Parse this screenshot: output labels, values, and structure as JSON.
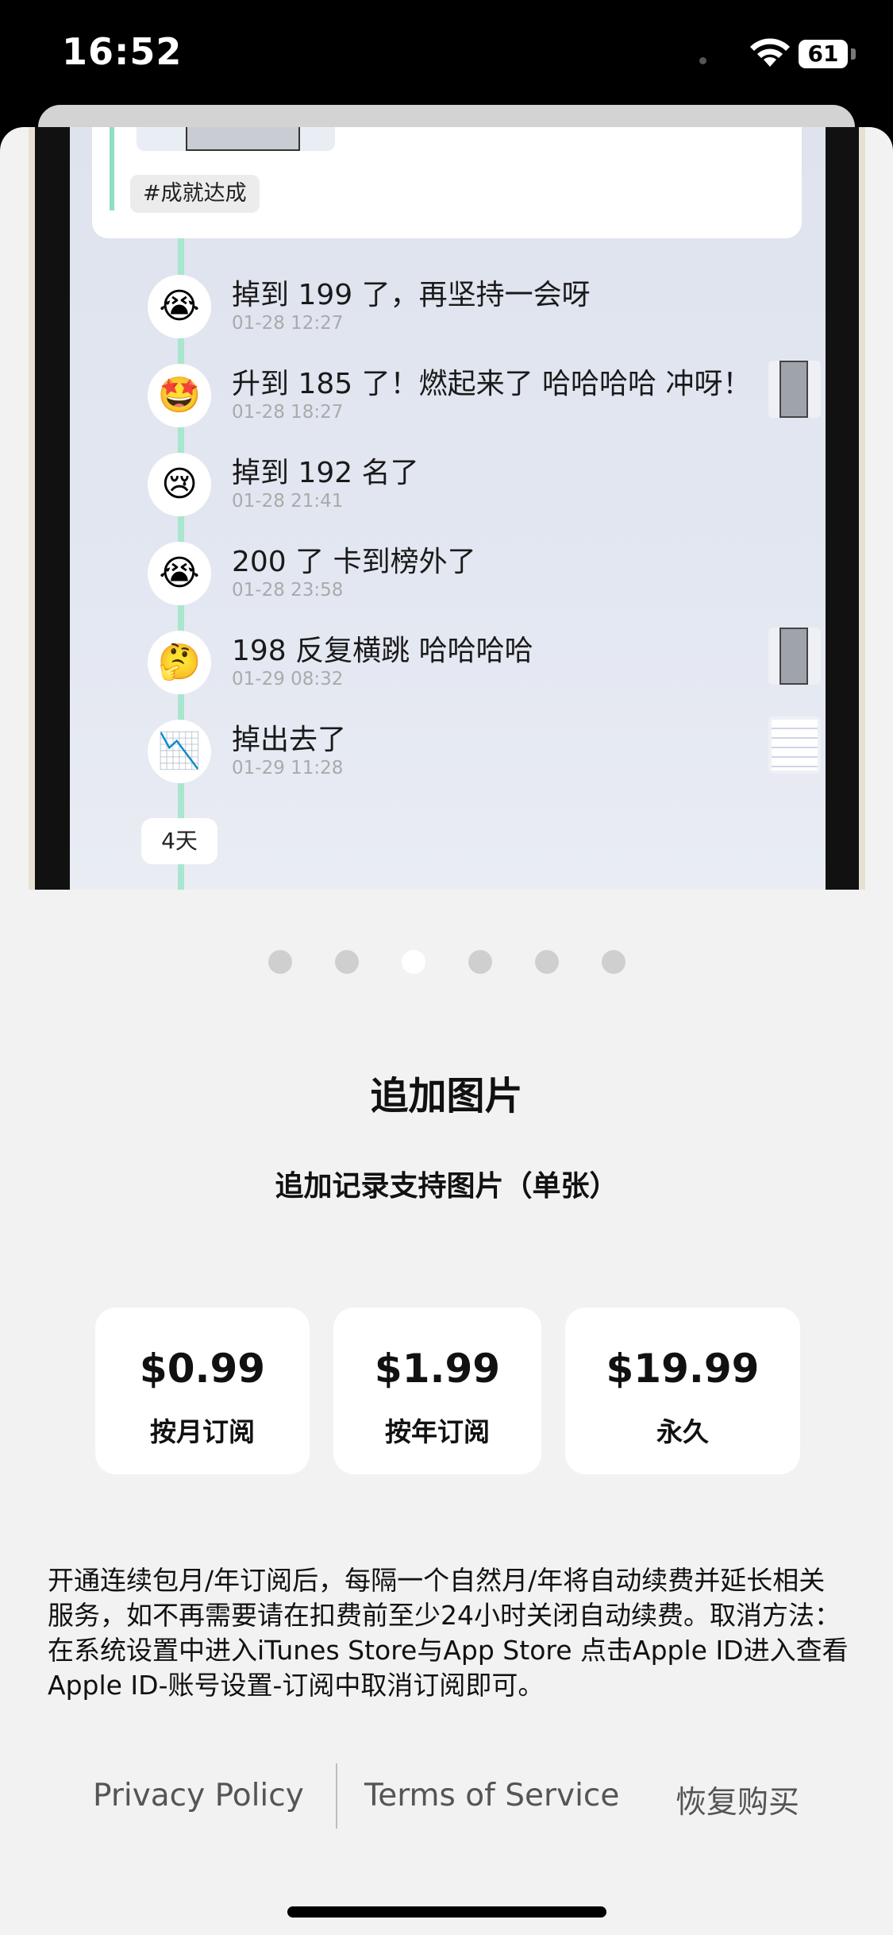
{
  "status_bar": {
    "time": "16:52",
    "battery": "61"
  },
  "preview": {
    "tag": "#成就达成",
    "entries": [
      {
        "emoji": "😭",
        "text": "掉到 199 了，再坚持一会呀",
        "date": "01-28 12:27"
      },
      {
        "emoji": "🤩",
        "text": "升到 185 了！燃起来了 哈哈哈哈 冲呀！",
        "date": "01-28 18:27"
      },
      {
        "emoji": "😢",
        "text": "掉到 192 名了",
        "date": "01-28 21:41"
      },
      {
        "emoji": "😭",
        "text": "200 了 卡到榜外了",
        "date": "01-28 23:58"
      },
      {
        "emoji": "🤔",
        "text": "198 反复横跳 哈哈哈哈",
        "date": "01-29 08:32"
      },
      {
        "emoji": "📉",
        "text": "掉出去了",
        "date": "01-29 11:28"
      }
    ],
    "days_badge": "4天"
  },
  "pagination": {
    "count": 6,
    "active_index": 2
  },
  "feature": {
    "title": "追加图片",
    "subtitle": "追加记录支持图片（单张）"
  },
  "plans": [
    {
      "price": "$0.99",
      "label": "按月订阅"
    },
    {
      "price": "$1.99",
      "label": "按年订阅"
    },
    {
      "price": "$19.99",
      "label": "永久"
    }
  ],
  "description": "开通连续包月/年订阅后，每隔一个自然月/年将自动续费并延长相关服务，如不再需要请在扣费前至少24小时关闭自动续费。取消方法：在系统设置中进入iTunes Store与App Store 点击Apple ID进入查看Apple ID-账号设置-订阅中取消订阅即可。",
  "footer": {
    "privacy": "Privacy Policy",
    "terms": "Terms of Service",
    "restore": "恢复购买"
  }
}
